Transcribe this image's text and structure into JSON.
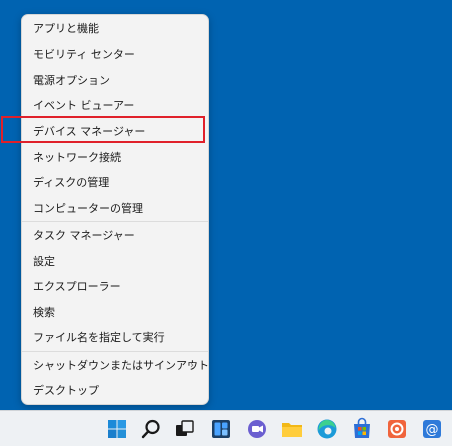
{
  "menu": {
    "items": [
      {
        "label": "アプリと機能"
      },
      {
        "label": "モビリティ センター"
      },
      {
        "label": "電源オプション"
      },
      {
        "label": "イベント ビューアー"
      },
      {
        "label": "デバイス マネージャー"
      },
      {
        "label": "ネットワーク接続"
      },
      {
        "label": "ディスクの管理"
      },
      {
        "label": "コンピューターの管理"
      },
      {
        "label": "タスク マネージャー"
      },
      {
        "label": "設定"
      },
      {
        "label": "エクスプローラー"
      },
      {
        "label": "検索"
      },
      {
        "label": "ファイル名を指定して実行"
      },
      {
        "label": "シャットダウンまたはサインアウト",
        "chevron": "›"
      },
      {
        "label": "デスクトップ"
      }
    ]
  },
  "taskbar": {
    "icons": [
      "start-icon",
      "search-icon",
      "task-view-icon",
      "widgets-icon",
      "chat-icon",
      "file-explorer-icon",
      "edge-icon",
      "store-icon",
      "app-orange-icon",
      "mail-icon"
    ]
  },
  "colors": {
    "desktop": "#0063b1",
    "highlight": "#e0202a"
  }
}
